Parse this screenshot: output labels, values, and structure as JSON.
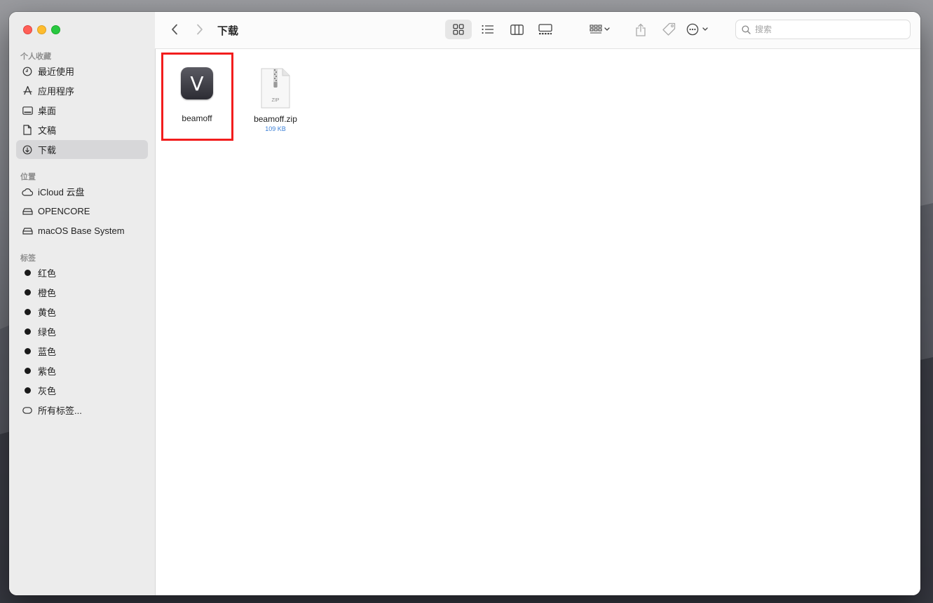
{
  "window": {
    "title": "下载"
  },
  "sidebar": {
    "sections": [
      {
        "title": "个人收藏",
        "items": [
          {
            "label": "最近使用",
            "icon": "clock-icon"
          },
          {
            "label": "应用程序",
            "icon": "applications-icon"
          },
          {
            "label": "桌面",
            "icon": "desktop-icon"
          },
          {
            "label": "文稿",
            "icon": "document-icon"
          },
          {
            "label": "下载",
            "icon": "download-icon",
            "selected": true
          }
        ]
      },
      {
        "title": "位置",
        "items": [
          {
            "label": "iCloud 云盘",
            "icon": "cloud-icon"
          },
          {
            "label": "OPENCORE",
            "icon": "drive-icon"
          },
          {
            "label": "macOS Base System",
            "icon": "drive-icon"
          }
        ]
      },
      {
        "title": "标签",
        "items": [
          {
            "label": "红色",
            "icon": "tag-dot-icon"
          },
          {
            "label": "橙色",
            "icon": "tag-dot-icon"
          },
          {
            "label": "黄色",
            "icon": "tag-dot-icon"
          },
          {
            "label": "绿色",
            "icon": "tag-dot-icon"
          },
          {
            "label": "蓝色",
            "icon": "tag-dot-icon"
          },
          {
            "label": "紫色",
            "icon": "tag-dot-icon"
          },
          {
            "label": "灰色",
            "icon": "tag-dot-icon"
          },
          {
            "label": "所有标签...",
            "icon": "all-tags-icon"
          }
        ]
      }
    ]
  },
  "toolbar": {
    "search_placeholder": "搜索",
    "view_mode": "icon"
  },
  "files": [
    {
      "name": "beamoff",
      "type": "application",
      "icon_letter": "V",
      "highlighted": true
    },
    {
      "name": "beamoff.zip",
      "type": "zip",
      "size": "109 KB",
      "icon_text": "ZIP"
    }
  ],
  "colors": {
    "highlight": "#f21d1d",
    "selected_row": "#d7d7d9",
    "size_text": "#3b7fd6"
  }
}
